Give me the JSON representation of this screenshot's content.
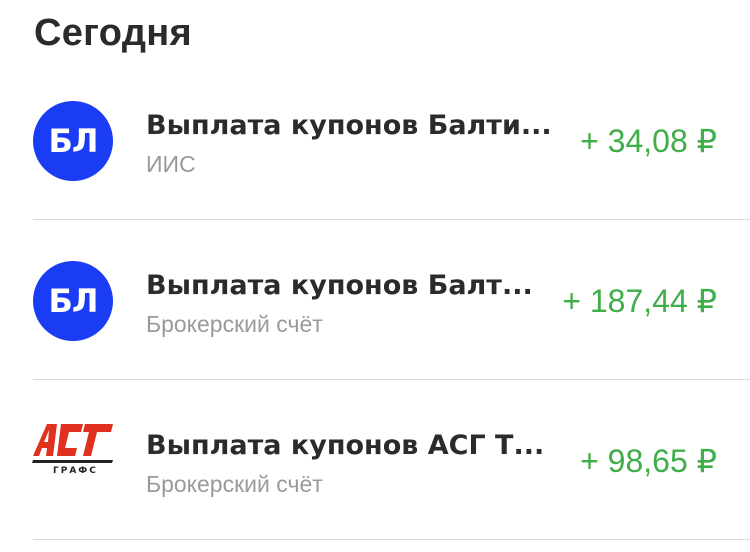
{
  "section": {
    "title": "Сегодня"
  },
  "operations": [
    {
      "icon": "baltic-leasing-logo-icon",
      "icon_text": "БЛ",
      "icon_color": "#1a3cf5",
      "title": "Выплата купонов Балти...",
      "account": "ИИС",
      "amount": "+ 34,08 ₽"
    },
    {
      "icon": "baltic-leasing-logo-icon",
      "icon_text": "БЛ",
      "icon_color": "#1a3cf5",
      "title": "Выплата купонов Балт...",
      "account": "Брокерский счёт",
      "amount": "+ 187,44 ₽"
    },
    {
      "icon": "asg-logo-icon",
      "icon_text": "АСГ",
      "icon_subtext": "ГРАФС",
      "title": "Выплата купонов АСГ Т...",
      "account": "Брокерский счёт",
      "amount": "+ 98,65 ₽"
    }
  ],
  "colors": {
    "amount_positive": "#3fae49",
    "title_text": "#2b2b2b",
    "secondary_text": "#9a9a9a",
    "divider": "#dcdcdc"
  }
}
